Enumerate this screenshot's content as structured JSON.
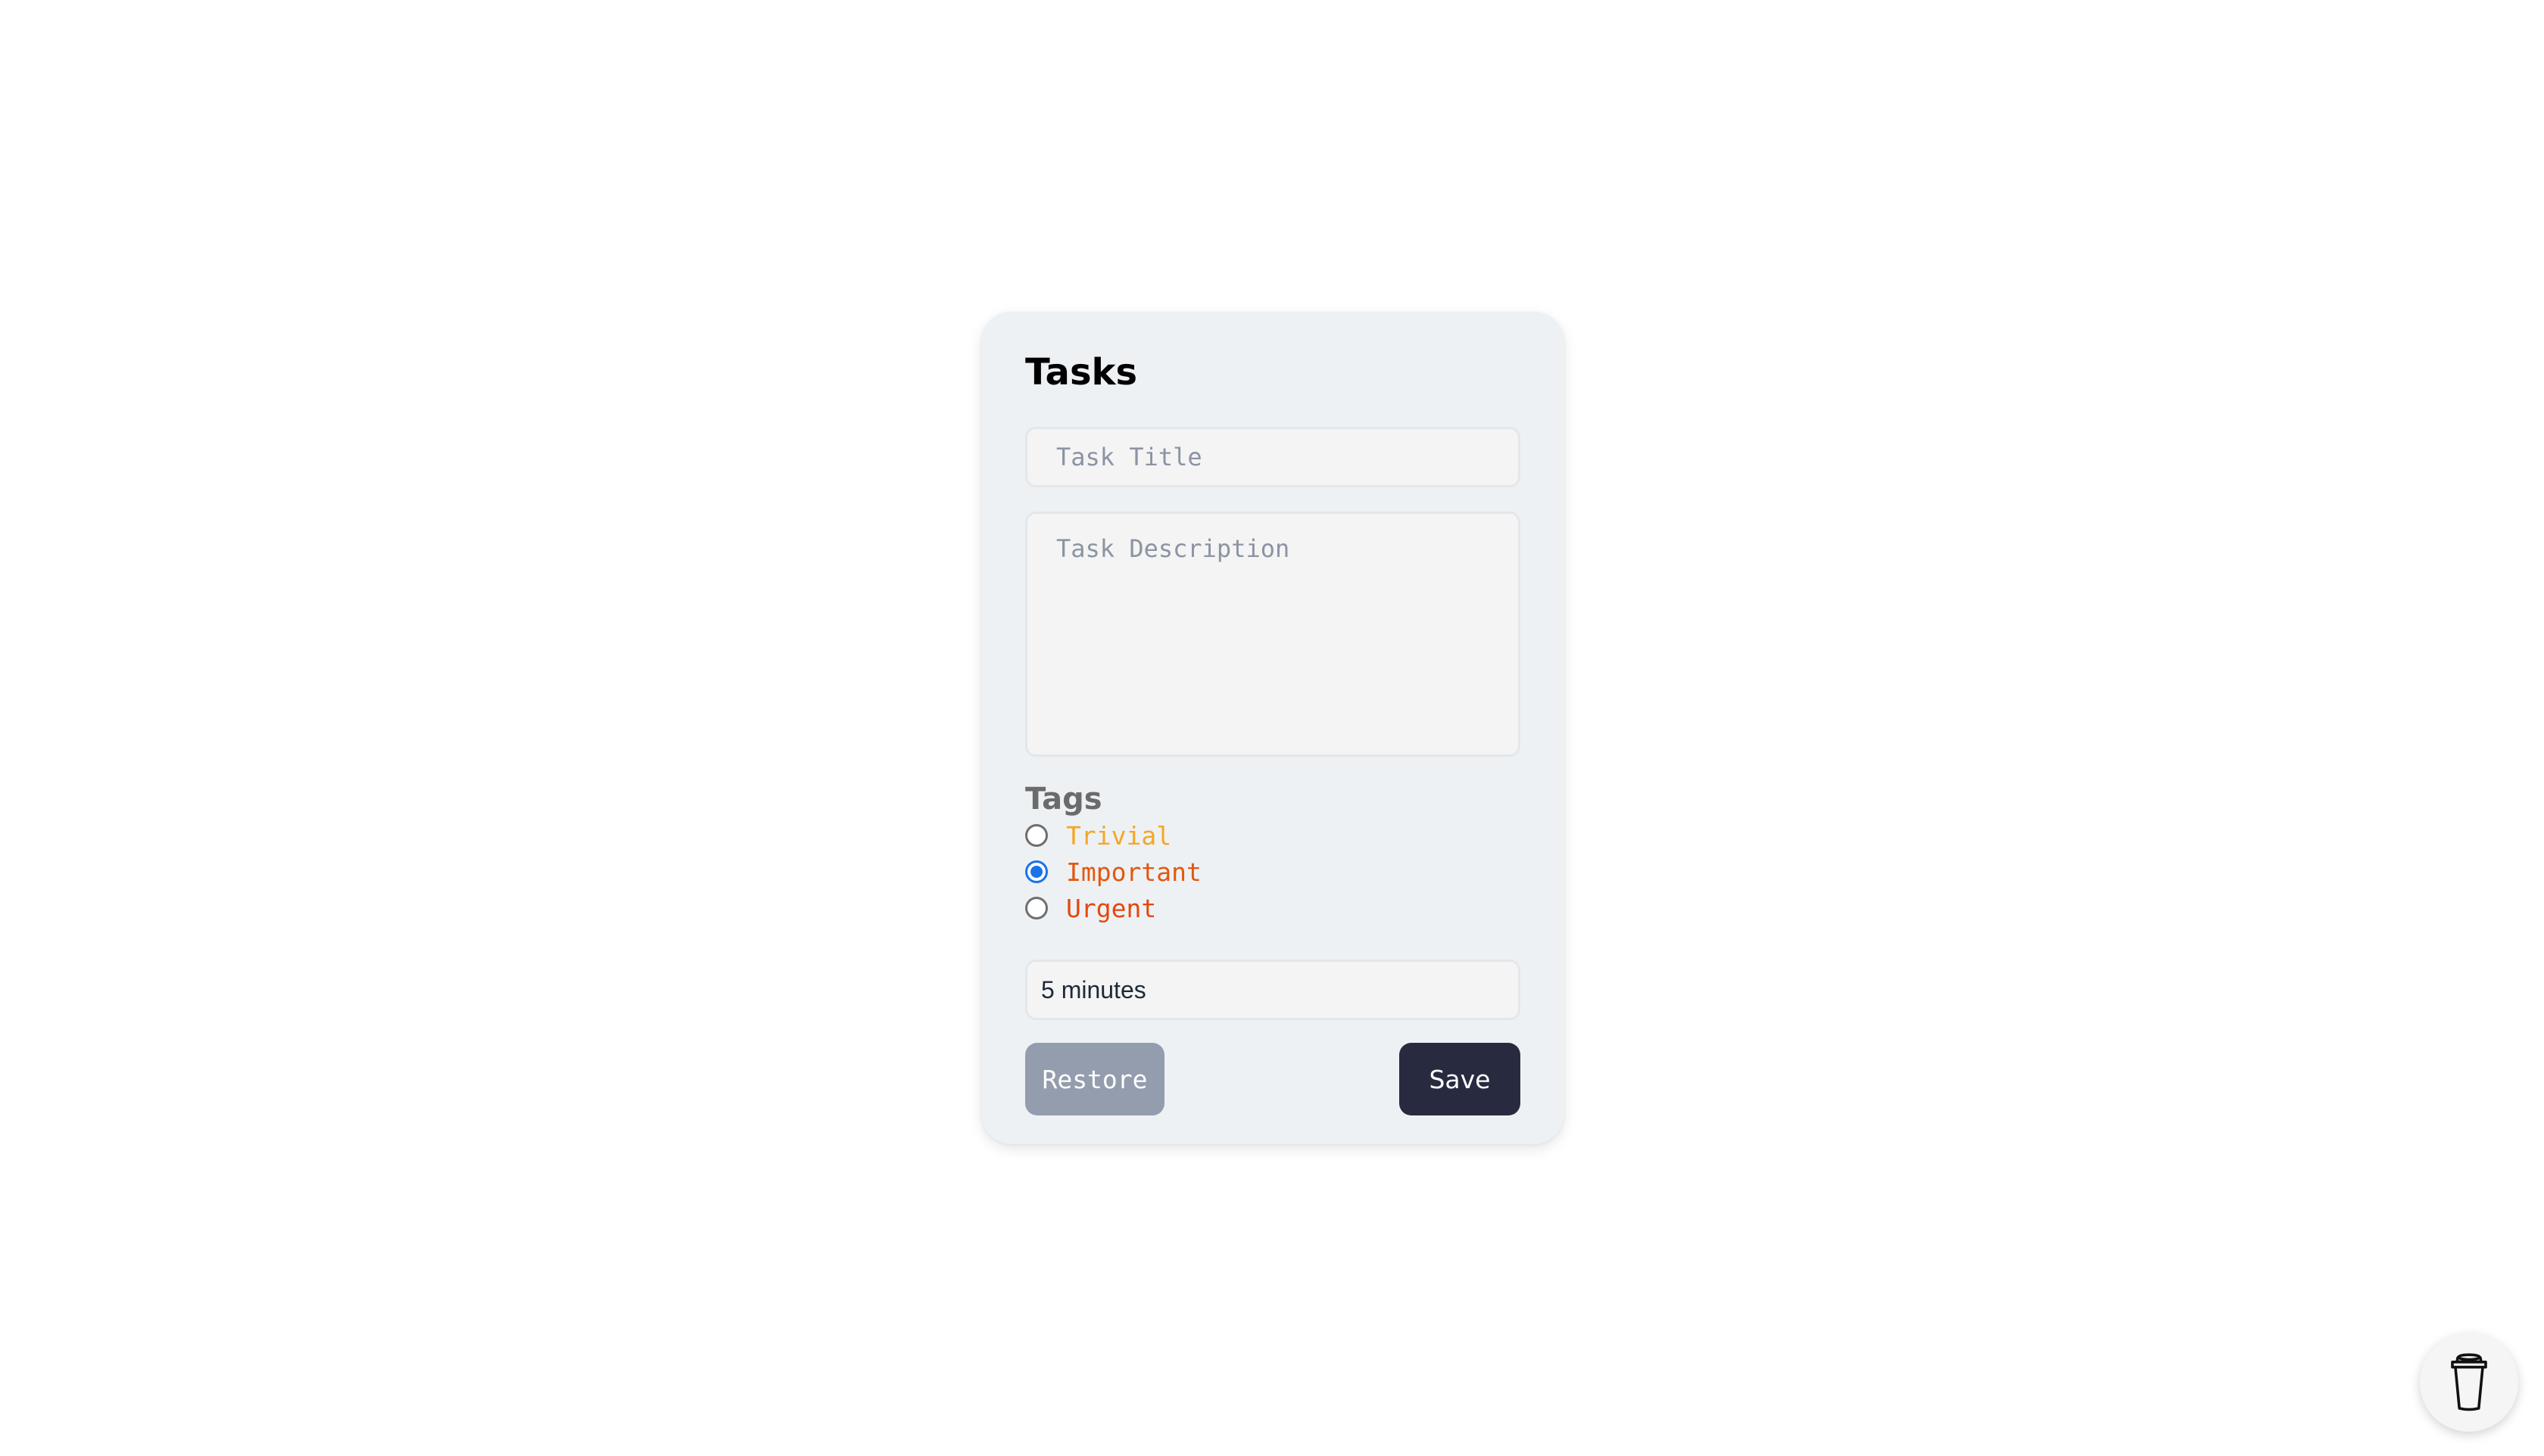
{
  "form": {
    "title": "Tasks",
    "task_title": {
      "value": "",
      "placeholder": "Task Title"
    },
    "task_description": {
      "value": "",
      "placeholder": "Task Description"
    },
    "tags": {
      "heading": "Tags",
      "options": [
        {
          "label": "Trivial",
          "color": "#f5a623",
          "checked": false
        },
        {
          "label": "Important",
          "color": "#e4570e",
          "checked": true
        },
        {
          "label": "Urgent",
          "color": "#e4470e",
          "checked": false
        }
      ]
    },
    "duration": {
      "selected": "5 minutes"
    },
    "buttons": {
      "restore_label": "Restore",
      "save_label": "Save"
    }
  },
  "floating_button": {
    "icon": "coffee-cup-icon"
  },
  "colors": {
    "card_bg": "#edf1f4",
    "radio_accent": "#1a73e8",
    "save_bg": "#282b3f",
    "restore_bg": "#939dae"
  }
}
